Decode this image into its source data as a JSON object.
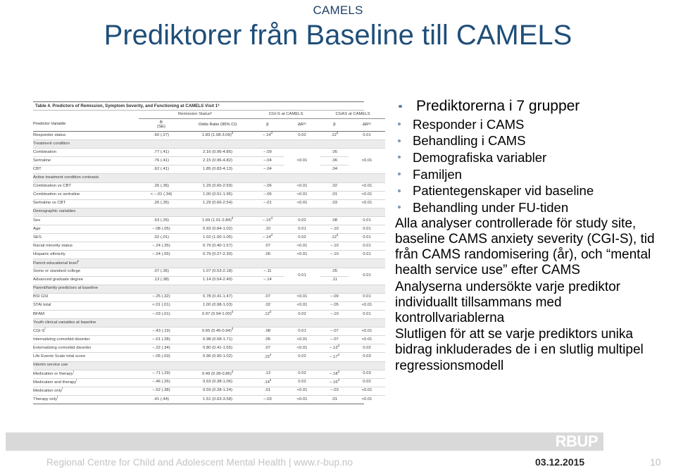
{
  "slide": {
    "eyebrow": "CAMELS",
    "title": "Prediktorer från Baseline till CAMELS"
  },
  "figure": {
    "caption": "Table 4. Predictors of Remission, Symptom Severity, and Functioning at CAMELS Visit 1ª",
    "group_headers": {
      "remission": "Remission Statusᵇ",
      "cgis": "CGI-S at CAMELS",
      "cgas": "CGAS at CAMELS"
    },
    "column_headers": {
      "variable": "Predictor Variable",
      "b": "B",
      "se": "(SE)",
      "odds": "Odds Ratio (95% CI)",
      "beta1": "β",
      "dr1": "ΔR²ᶜ",
      "beta2": "β",
      "dr2": "ΔR²ᶜ"
    },
    "rows": [
      {
        "type": "data",
        "indent": 0,
        "name": "Responder status",
        "b": ".60 (.27)",
        "odds": "1.83 (1.08-3.09)ᵈ",
        "beta1": "−.14ᵈ",
        "dr1": "0.02",
        "beta2": ".12ᵈ",
        "dr2": "0.01"
      },
      {
        "type": "section",
        "indent": 0,
        "name": "Treatment condition"
      },
      {
        "type": "data",
        "indent": 1,
        "name": "Combination",
        "b": ".77 (.41)",
        "odds": "2.16 (0.96-4.85)",
        "beta1": "−.09",
        "dr1": "",
        "beta2": ".05",
        "dr2": ""
      },
      {
        "type": "data",
        "indent": 1,
        "name": "Sertraline",
        "b": ".76 (.41)",
        "odds": "2.15 (0.96-4.82)",
        "beta1": "−.04",
        "dr1": "<0.01",
        "beta2": ".06",
        "dr2": "<0.01"
      },
      {
        "type": "data",
        "indent": 1,
        "name": "CBT",
        "b": ".62 (.41)",
        "odds": "1.85 (0.83-4.13)",
        "beta1": "−.04",
        "dr1": "",
        "beta2": ".04",
        "dr2": ""
      },
      {
        "type": "section",
        "indent": 0,
        "name": "Active treatment condition contrasts"
      },
      {
        "type": "data",
        "indent": 1,
        "name": "Combination vs CBT",
        "b": ".26 (.36)",
        "odds": "1.29 (0.65-2.59)",
        "beta1": "−.06",
        "dr1": "<0.01",
        "beta2": ".02",
        "dr2": "<0.01"
      },
      {
        "type": "data",
        "indent": 1,
        "name": "Combination vs sertraline",
        "b": "< −.01 (.34)",
        "odds": "1.00 (0.51-1.95)",
        "beta1": "−.06",
        "dr1": "<0.01",
        "beta2": ".01",
        "dr2": "<0.01"
      },
      {
        "type": "data",
        "indent": 1,
        "name": "Sertraline vs CBT",
        "b": ".26 (.35)",
        "odds": "1.29 (0.66-2.54)",
        "beta1": "−.01",
        "dr1": "<0.01",
        "beta2": ".03",
        "dr2": "<0.01"
      },
      {
        "type": "section",
        "indent": 0,
        "name": "Demographic variables"
      },
      {
        "type": "data",
        "indent": 1,
        "name": "Sex",
        "b": ".53 (.26)",
        "odds": "1.69 (1.01-2.84)ᵈ",
        "beta1": "−.15ᵈ",
        "dr1": "0.02",
        "beta2": ".08",
        "dr2": "0.01"
      },
      {
        "type": "data",
        "indent": 1,
        "name": "Age",
        "b": "−.08 (.05)",
        "odds": "0.93 (0.84-1.02)",
        "beta1": ".10",
        "dr1": "0.01",
        "beta2": "−.10",
        "dr2": "0.01"
      },
      {
        "type": "data",
        "indent": 1,
        "name": "SES",
        "b": ".02 (.01)",
        "odds": "1.02 (1.00-1.05)",
        "beta1": "−.14ᵈ",
        "dr1": "0.02",
        "beta2": ".12ᵈ",
        "dr2": "0.01"
      },
      {
        "type": "data",
        "indent": 1,
        "name": "Racial minority status",
        "b": "−.24 (.35)",
        "odds": "0.79 (0.40-1.57)",
        "beta1": ".07",
        "dr1": "<0.01",
        "beta2": "−.10",
        "dr2": "0.01"
      },
      {
        "type": "data",
        "indent": 1,
        "name": "Hispanic ethnicity",
        "b": "−.24 (.55)",
        "odds": "0.79 (0.27-2.30)",
        "beta1": ".06",
        "dr1": "<0.01",
        "beta2": "−.10",
        "dr2": "0.01"
      },
      {
        "type": "section",
        "indent": 1,
        "name": "Parent educational levelᵉ"
      },
      {
        "type": "data",
        "indent": 2,
        "name": "Some or standard college",
        "b": ".07 (.36)",
        "odds": "1.07 (0.53-2.18)",
        "beta1": "−.11",
        "dr1": "0.01",
        "beta2": ".05",
        "dr2": "0.01"
      },
      {
        "type": "data",
        "indent": 2,
        "name": "Advanced graduate degree",
        "b": ".13 (.38)",
        "odds": "1.14 (0.54-2.40)",
        "beta1": "−.14",
        "dr1": "",
        "beta2": ".11",
        "dr2": ""
      },
      {
        "type": "section",
        "indent": 0,
        "name": "Parent/family predictors at baseline"
      },
      {
        "type": "data",
        "indent": 1,
        "name": "BSI GSI",
        "b": "−.25 (.32)",
        "odds": "0.78 (0.41-1.47)",
        "beta1": ".07",
        "dr1": "<0.01",
        "beta2": "−.09",
        "dr2": "0.01"
      },
      {
        "type": "data",
        "indent": 1,
        "name": "STAI total",
        "b": "<.01 (.01)",
        "odds": "1.00 (0.98-1.03)",
        "beta1": ".02",
        "dr1": "<0.01",
        "beta2": "−.05",
        "dr2": "<0.01"
      },
      {
        "type": "data",
        "indent": 1,
        "name": "BFAM",
        "b": "−.03 (.01)",
        "odds": "0.97 (0.94-1.00)ᵈ",
        "beta1": ".12ᵈ",
        "dr1": "0.02",
        "beta2": "−.10",
        "dr2": "0.01"
      },
      {
        "type": "section",
        "indent": 0,
        "name": "Youth clinical variables at baseline"
      },
      {
        "type": "data",
        "indent": 1,
        "name": "CGI-Sᶠ",
        "b": "−.43 (.19)",
        "odds": "0.65 (0.45-0.94)ᵈ",
        "beta1": ".08",
        "dr1": "0.01",
        "beta2": "−.07",
        "dr2": "<0.01"
      },
      {
        "type": "data",
        "indent": 1,
        "name": "Internalizing comorbid disorder",
        "b": "−.01 (.28)",
        "odds": "0.98 (0.58-1.71)",
        "beta1": ".05",
        "dr1": "<0.01",
        "beta2": "−.07",
        "dr2": "<0.01"
      },
      {
        "type": "data",
        "indent": 1,
        "name": "Externalizing comorbid disorder",
        "b": "−.22 (.34)",
        "odds": "0.80 (0.41-1.55)",
        "beta1": ".07",
        "dr1": "<0.01",
        "beta2": "−.13ᵈ",
        "dr2": "0.02"
      },
      {
        "type": "data",
        "indent": 1,
        "name": "Life Events Scale total score",
        "b": "−.05 (.03)",
        "odds": "0.96 (0.90-1.02)",
        "beta1": ".15ᵈ",
        "dr1": "0.02",
        "beta2": "−.17ᵈ",
        "dr2": "0.03"
      },
      {
        "type": "section",
        "indent": 0,
        "name": "Interim service use"
      },
      {
        "type": "data",
        "indent": 1,
        "name": "Medication or therapyᶠ",
        "b": "−.71 (.29)",
        "odds": "0.49 (0.28-0.86)ᵈ",
        "beta1": ".13",
        "dr1": "0.02",
        "beta2": "−.18ᵈ",
        "dr2": "0.03"
      },
      {
        "type": "data",
        "indent": 1,
        "name": "Medication and therapyᶠ",
        "b": "−.46 (.26)",
        "odds": "0.63 (0.38-1.06)",
        "beta1": ".14ᵈ",
        "dr1": "0.02",
        "beta2": "−.16ᵈ",
        "dr2": "0.02"
      },
      {
        "type": "data",
        "indent": 1,
        "name": "Medication onlyᶠ",
        "b": "−.52 (.38)",
        "odds": "0.59 (0.28-1.24)",
        "beta1": ".01",
        "dr1": "<0.01",
        "beta2": "−.03",
        "dr2": "<0.01"
      },
      {
        "type": "data",
        "indent": 1,
        "name": "Therapy onlyᶠ",
        "b": ".41 (.44)",
        "odds": "1.51 (0.63-3.58)",
        "beta1": "−.03",
        "dr1": "<0.01",
        "beta2": ".01",
        "dr2": "<0.01"
      }
    ]
  },
  "content": {
    "heading": "Prediktorerna i 7 grupper",
    "groups": [
      "Responder i CAMS",
      "Behandling i CAMS",
      "Demografiska variabler",
      "Familjen",
      "Patientegenskaper vid baseline",
      "Behandling under FU-tiden"
    ],
    "paragraphs": [
      "Alla analyser controllerade för study site, baseline CAMS anxiety severity (CGI-S), tid från CAMS randomisering (år), och “mental health service use” efter CAMS",
      "Analyserna undersökte varje prediktor individuallt tillsammans med kontrollvariablerna",
      "Slutligen för att se varje prediktors unika bidrag inkluderades de i en slutlig multipel regressionsmodell"
    ]
  },
  "footer": {
    "logo": "RBUP",
    "text": "Regional Centre for Child and Adolescent Mental Health | www.r-bup.no",
    "date": "03.12.2015",
    "page": "10"
  },
  "colors": {
    "title": "#1f4e79",
    "eyebrow": "#1f4068",
    "bullet_level1": "#5b7fa6",
    "bullet_level2": "#7d98b5",
    "footer_bar": "#d9d9d9",
    "footer_text": "#c3c3c3",
    "table_section_bg": "#ececec"
  }
}
